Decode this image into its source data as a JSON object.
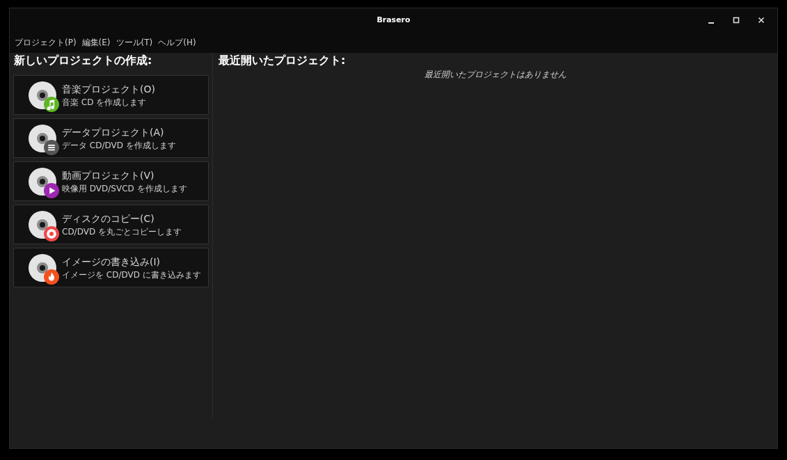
{
  "window": {
    "title": "Brasero"
  },
  "menu": [
    {
      "label": "プロジェクト(P)"
    },
    {
      "label": "編集(E)"
    },
    {
      "label": "ツール(T)"
    },
    {
      "label": "ヘルプ(H)"
    }
  ],
  "new_project": {
    "heading": "新しいプロジェクトの作成:",
    "items": [
      {
        "kind": "music",
        "color": "#5fb526",
        "title": "音楽プロジェクト(O)",
        "description": "音楽 CD を作成します"
      },
      {
        "kind": "data",
        "color": "#555555",
        "title": "データプロジェクト(A)",
        "description": "データ CD/DVD を作成します"
      },
      {
        "kind": "video",
        "color": "#9c27b0",
        "title": "動画プロジェクト(V)",
        "description": "映像用 DVD/SVCD を作成します"
      },
      {
        "kind": "copy",
        "color": "#f04848",
        "title": "ディスクのコピー(C)",
        "description": "CD/DVD を丸ごとコピーします"
      },
      {
        "kind": "burn",
        "color": "#f4511e",
        "title": "イメージの書き込み(I)",
        "description": "イメージを CD/DVD に書き込みます"
      }
    ]
  },
  "recent": {
    "heading": "最近開いたプロジェクト:",
    "empty_message": "最近開いたプロジェクトはありません"
  }
}
